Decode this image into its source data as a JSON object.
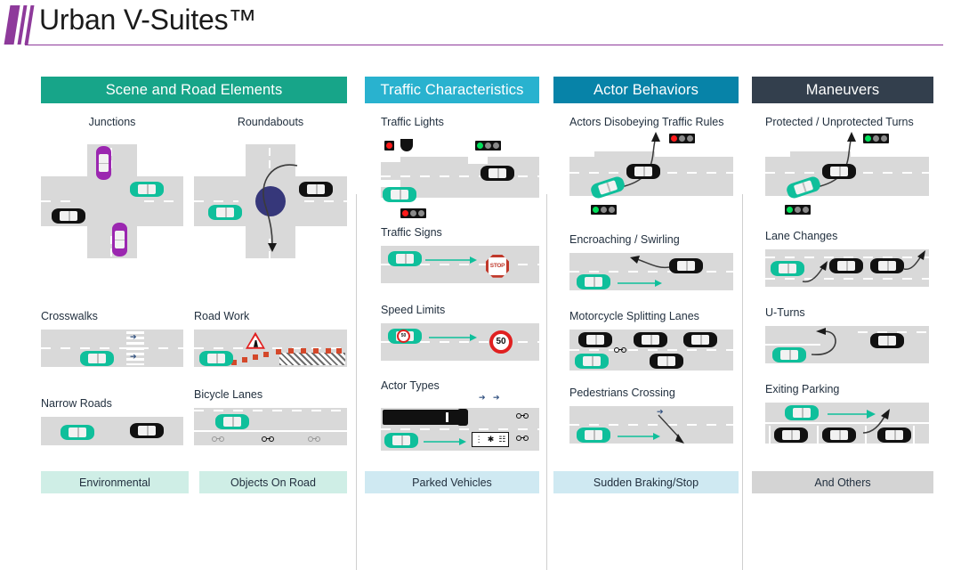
{
  "header": {
    "title": "Urban V-Suites™",
    "logo_name": "urban-v-suites-logo",
    "accent_color": "#8e3a9b"
  },
  "columns": [
    {
      "id": "scene-and-road-elements",
      "heading": "Scene and Road Elements",
      "heading_color": "#17a589",
      "footer_color": "#cfeee6",
      "cards": [
        {
          "title": "Junctions"
        },
        {
          "title": "Roundabouts"
        },
        {
          "title": "Crosswalks"
        },
        {
          "title": "Road Work"
        },
        {
          "title": "Narrow Roads"
        },
        {
          "title": "Bicycle Lanes"
        }
      ],
      "footers": [
        "Environmental",
        "Objects On Road"
      ]
    },
    {
      "id": "traffic-characteristics",
      "heading": "Traffic Characteristics",
      "heading_color": "#29b2cf",
      "footer_color": "#cfe9f2",
      "cards": [
        {
          "title": "Traffic Lights"
        },
        {
          "title": "Traffic Signs"
        },
        {
          "title": "Speed Limits"
        },
        {
          "title": "Actor Types"
        }
      ],
      "footers": [
        "Parked Vehicles"
      ]
    },
    {
      "id": "actor-behaviors",
      "heading": "Actor Behaviors",
      "heading_color": "#0783a8",
      "footer_color": "#cfe9f2",
      "cards": [
        {
          "title": "Actors Disobeying Traffic Rules"
        },
        {
          "title": "Encroaching / Swirling"
        },
        {
          "title": "Motorcycle Splitting Lanes"
        },
        {
          "title": "Pedestrians Crossing"
        }
      ],
      "footers": [
        "Sudden Braking/Stop"
      ]
    },
    {
      "id": "maneuvers",
      "heading": "Maneuvers",
      "heading_color": "#333f4d",
      "footer_color": "#d4d4d4",
      "cards": [
        {
          "title": "Protected / Unprotected Turns"
        },
        {
          "title": "Lane Changes"
        },
        {
          "title": "U-Turns"
        },
        {
          "title": "Exiting Parking"
        }
      ],
      "footers": [
        "And Others"
      ]
    }
  ],
  "signs": {
    "stop_label": "STOP",
    "speed_limit_value": "50",
    "speed_limit_value_small": "50"
  },
  "palette": {
    "road": "#d9d9d9",
    "lane_marking": "#ffffff",
    "ego_vehicle": "#0fbf9b",
    "other_vehicle": "#111111",
    "highlight_vehicle": "#9b27b0",
    "roundabout_island": "#36377a",
    "cone": "#d4482a",
    "signal_red": "#ff1a1a",
    "signal_green": "#00e05a"
  }
}
